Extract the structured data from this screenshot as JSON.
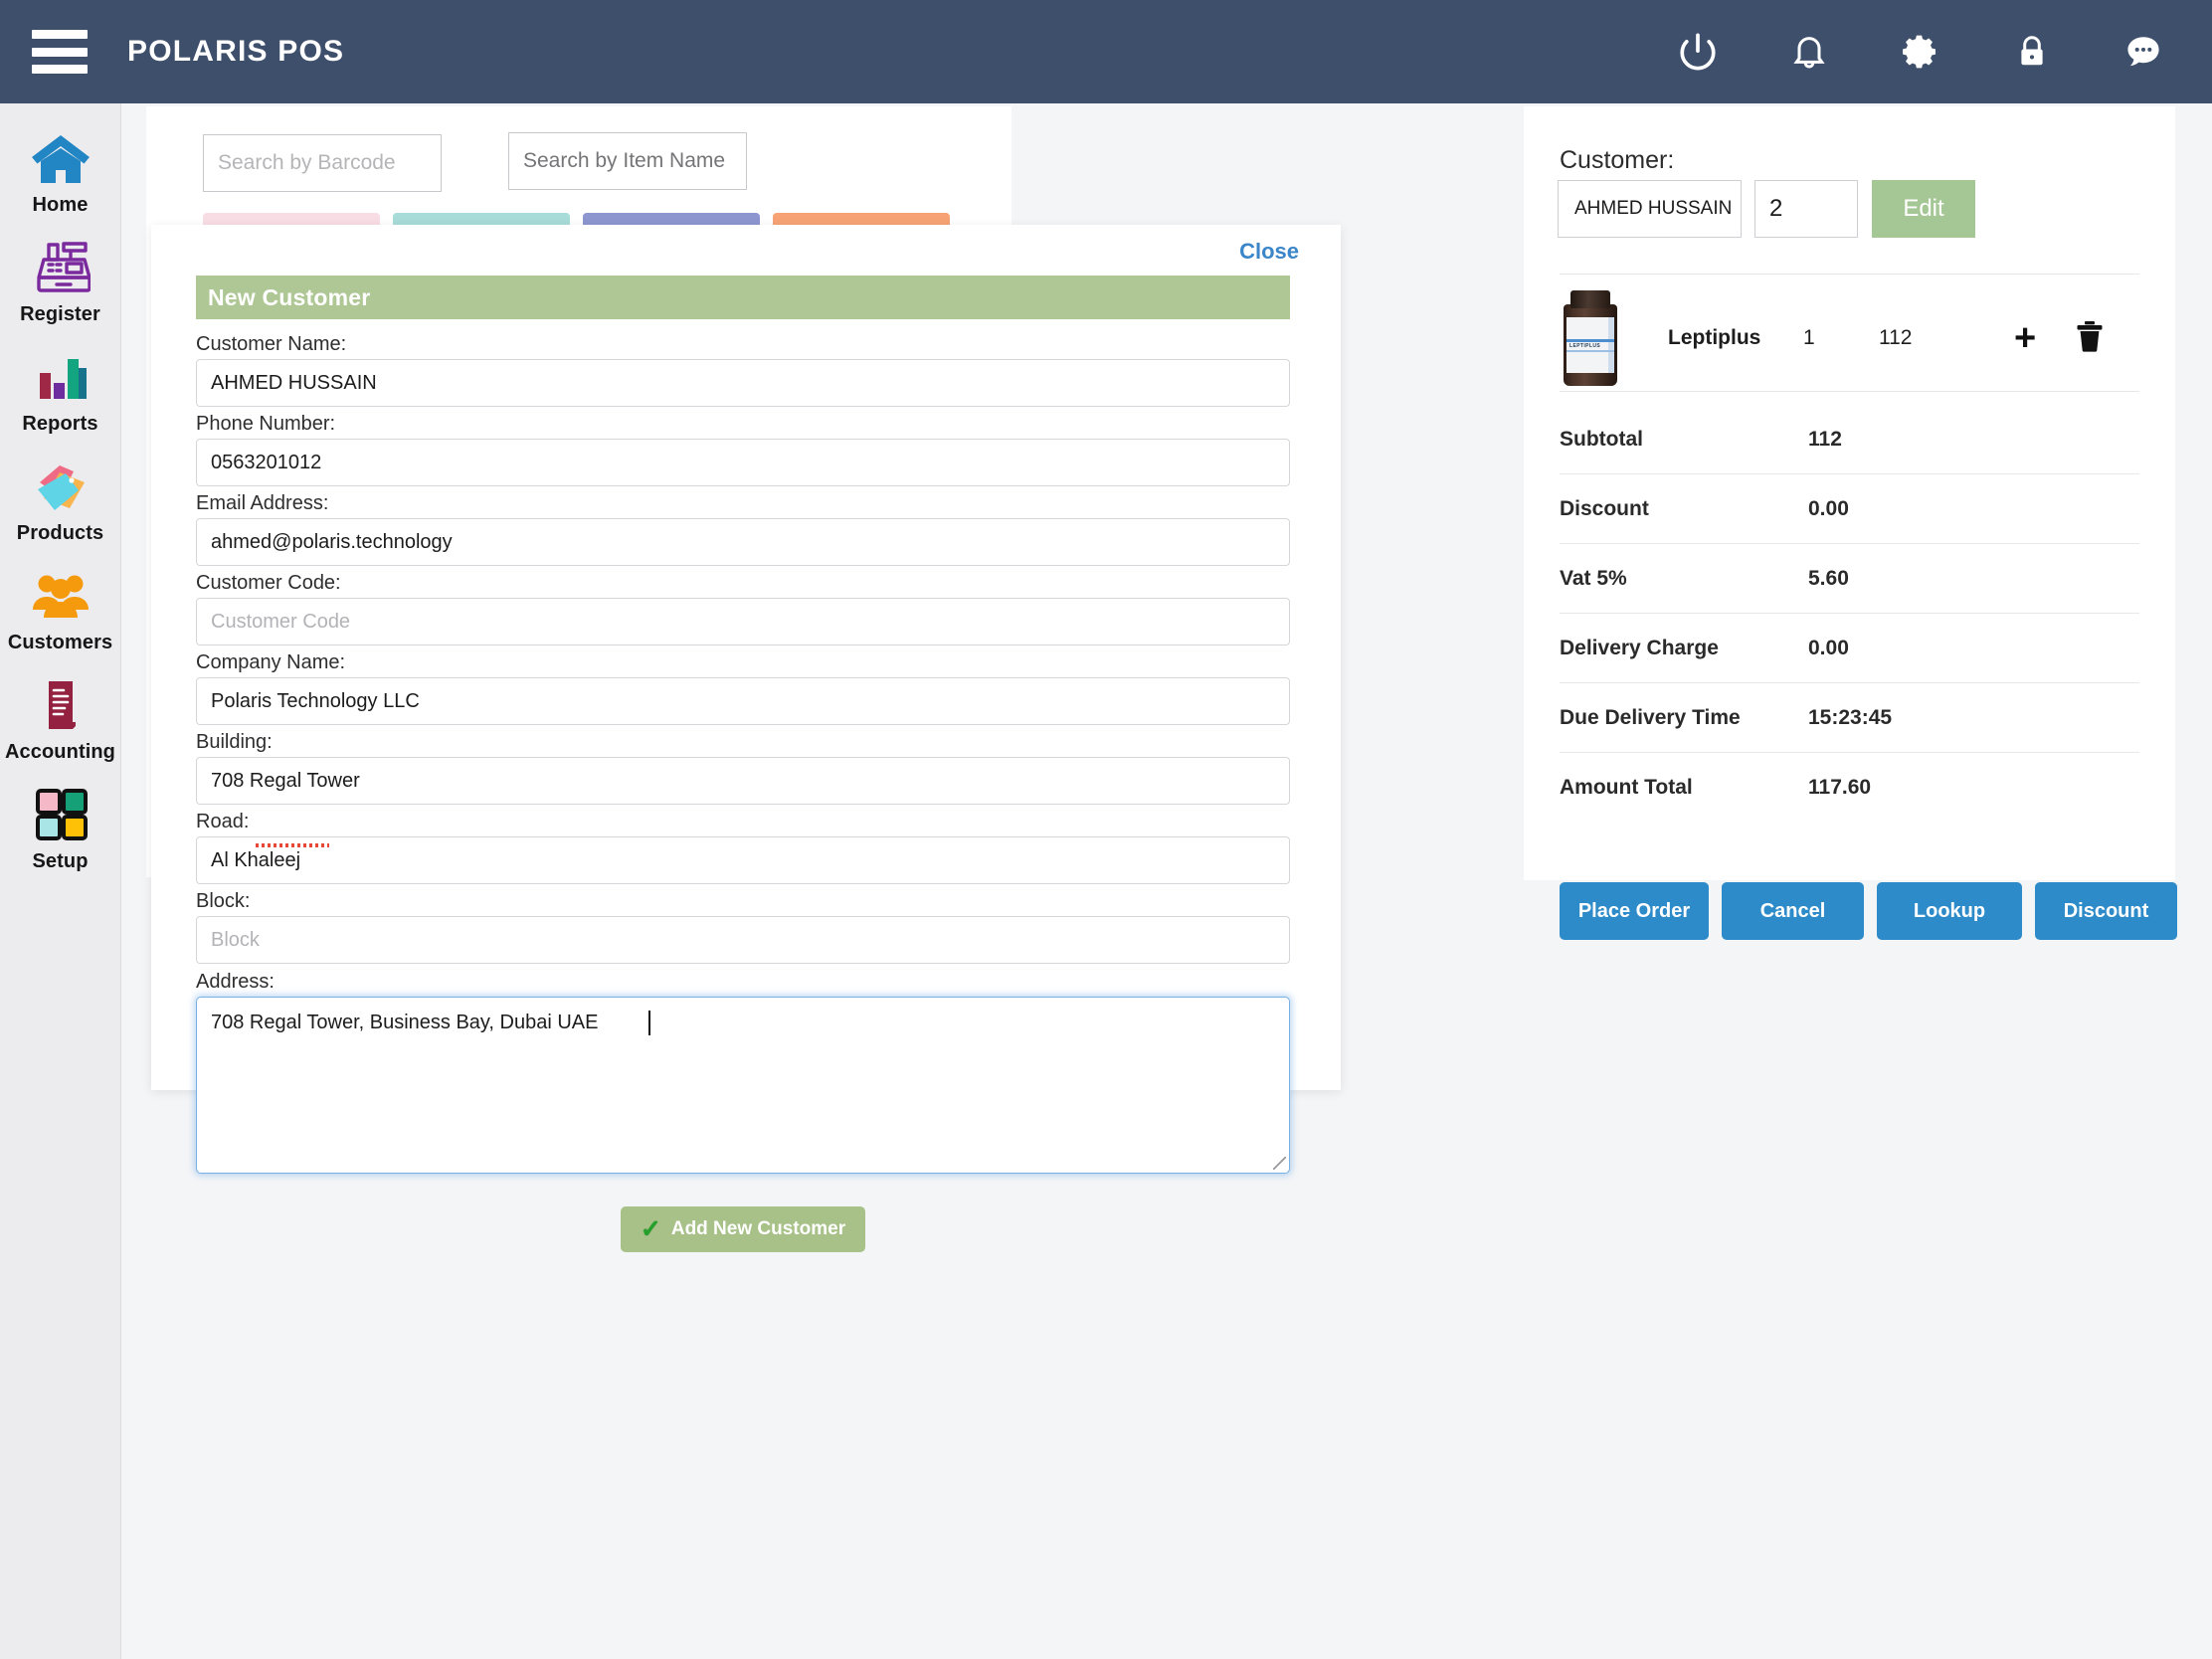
{
  "topbar": {
    "brand": "POLARIS POS",
    "menu_icon": "hamburger-menu-icon",
    "icons": [
      {
        "name": "power-icon",
        "label": "Power"
      },
      {
        "name": "bell-icon",
        "label": "Notifications"
      },
      {
        "name": "gear-icon",
        "label": "Settings"
      },
      {
        "name": "lock-icon",
        "label": "Lock"
      },
      {
        "name": "chat-icon",
        "label": "Messages"
      }
    ]
  },
  "sidebar": {
    "items": [
      {
        "label": "Home",
        "icon": "home-icon"
      },
      {
        "label": "Register",
        "icon": "cash-register-icon"
      },
      {
        "label": "Reports",
        "icon": "bar-chart-icon"
      },
      {
        "label": "Products",
        "icon": "price-tags-icon"
      },
      {
        "label": "Customers",
        "icon": "people-group-icon"
      },
      {
        "label": "Accounting",
        "icon": "receipt-icon"
      },
      {
        "label": "Setup",
        "icon": "four-squares-icon"
      }
    ]
  },
  "search": {
    "barcode_placeholder": "Search by Barcode",
    "itemname_placeholder": "Search by Item Name"
  },
  "category_tabs": [
    {
      "name": "category-tab-1",
      "color": "#f9dde4"
    },
    {
      "name": "category-tab-2",
      "color": "#a8dcd8"
    },
    {
      "name": "category-tab-3",
      "color": "#8d96cf"
    },
    {
      "name": "category-tab-4",
      "color": "#f6a274"
    }
  ],
  "modal": {
    "title": "New Customer",
    "close_label": "Close",
    "submit_label": "Add New Customer",
    "submit_icon": "green-check-icon",
    "fields": [
      {
        "label": "Customer Name:",
        "value": "AHMED HUSSAIN",
        "placeholder": "",
        "name": "customer-name-field"
      },
      {
        "label": "Phone Number:",
        "value": "0563201012",
        "placeholder": "",
        "name": "phone-number-field"
      },
      {
        "label": "Email Address:",
        "value": "ahmed@polaris.technology",
        "placeholder": "",
        "name": "email-address-field"
      },
      {
        "label": "Customer Code:",
        "value": "",
        "placeholder": "Customer Code",
        "name": "customer-code-field"
      },
      {
        "label": "Company Name:",
        "value": "Polaris Technology LLC",
        "placeholder": "",
        "name": "company-name-field"
      },
      {
        "label": "Building:",
        "value": "708 Regal Tower",
        "placeholder": "",
        "name": "building-field"
      },
      {
        "label": "Road:",
        "value": "Al Khaleej",
        "placeholder": "",
        "name": "road-field"
      },
      {
        "label": "Block:",
        "value": "",
        "placeholder": "Block",
        "name": "block-field"
      }
    ],
    "address": {
      "label": "Address:",
      "value": "708 Regal Tower, Business Bay, Dubai UAE",
      "placeholder": ""
    }
  },
  "cart": {
    "customer_label": "Customer:",
    "customer_name": "AHMED HUSSAIN",
    "customer_code": "2",
    "edit_label": "Edit",
    "item": {
      "name": "Leptiplus",
      "quantity": "1",
      "price": "112",
      "thumbnail_label": "LEPTIPLUS",
      "add_icon": "plus-icon",
      "delete_icon": "trash-icon"
    },
    "totals": [
      {
        "label": "Subtotal",
        "value": "112"
      },
      {
        "label": "Discount",
        "value": "0.00"
      },
      {
        "label": "Vat 5%",
        "value": "5.60"
      },
      {
        "label": "Delivery Charge",
        "value": "0.00"
      },
      {
        "label": "Due Delivery Time",
        "value": "15:23:45"
      },
      {
        "label": "Amount Total",
        "value": "117.60"
      }
    ],
    "actions": [
      {
        "label": "Place Order",
        "name": "place-order-button"
      },
      {
        "label": "Cancel",
        "name": "cancel-button"
      },
      {
        "label": "Lookup",
        "name": "lookup-button"
      },
      {
        "label": "Discount",
        "name": "discount-button"
      }
    ]
  },
  "colors": {
    "topbar": "#3e4f6b",
    "accent_blue": "#2e8bc9",
    "modal_header_green": "#aec794",
    "edit_green": "#a5c795",
    "submit_green": "#a7c189"
  }
}
